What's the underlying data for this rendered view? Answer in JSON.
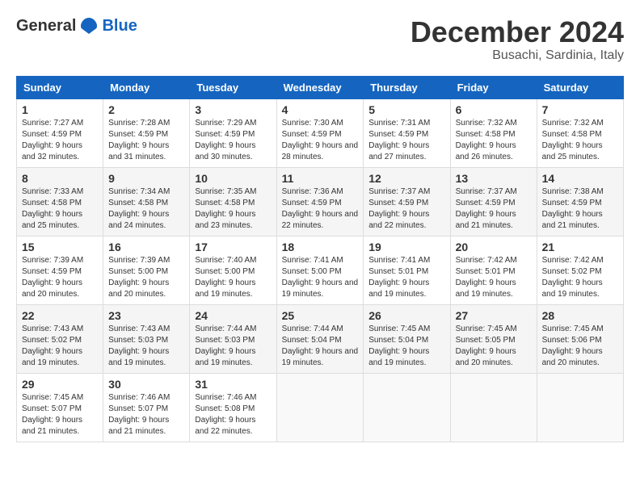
{
  "header": {
    "logo_general": "General",
    "logo_blue": "Blue",
    "month_title": "December 2024",
    "location": "Busachi, Sardinia, Italy"
  },
  "days_of_week": [
    "Sunday",
    "Monday",
    "Tuesday",
    "Wednesday",
    "Thursday",
    "Friday",
    "Saturday"
  ],
  "weeks": [
    [
      {
        "day": "1",
        "sunrise": "Sunrise: 7:27 AM",
        "sunset": "Sunset: 4:59 PM",
        "daylight": "Daylight: 9 hours and 32 minutes."
      },
      {
        "day": "2",
        "sunrise": "Sunrise: 7:28 AM",
        "sunset": "Sunset: 4:59 PM",
        "daylight": "Daylight: 9 hours and 31 minutes."
      },
      {
        "day": "3",
        "sunrise": "Sunrise: 7:29 AM",
        "sunset": "Sunset: 4:59 PM",
        "daylight": "Daylight: 9 hours and 30 minutes."
      },
      {
        "day": "4",
        "sunrise": "Sunrise: 7:30 AM",
        "sunset": "Sunset: 4:59 PM",
        "daylight": "Daylight: 9 hours and 28 minutes."
      },
      {
        "day": "5",
        "sunrise": "Sunrise: 7:31 AM",
        "sunset": "Sunset: 4:59 PM",
        "daylight": "Daylight: 9 hours and 27 minutes."
      },
      {
        "day": "6",
        "sunrise": "Sunrise: 7:32 AM",
        "sunset": "Sunset: 4:58 PM",
        "daylight": "Daylight: 9 hours and 26 minutes."
      },
      {
        "day": "7",
        "sunrise": "Sunrise: 7:32 AM",
        "sunset": "Sunset: 4:58 PM",
        "daylight": "Daylight: 9 hours and 25 minutes."
      }
    ],
    [
      {
        "day": "8",
        "sunrise": "Sunrise: 7:33 AM",
        "sunset": "Sunset: 4:58 PM",
        "daylight": "Daylight: 9 hours and 25 minutes."
      },
      {
        "day": "9",
        "sunrise": "Sunrise: 7:34 AM",
        "sunset": "Sunset: 4:58 PM",
        "daylight": "Daylight: 9 hours and 24 minutes."
      },
      {
        "day": "10",
        "sunrise": "Sunrise: 7:35 AM",
        "sunset": "Sunset: 4:58 PM",
        "daylight": "Daylight: 9 hours and 23 minutes."
      },
      {
        "day": "11",
        "sunrise": "Sunrise: 7:36 AM",
        "sunset": "Sunset: 4:59 PM",
        "daylight": "Daylight: 9 hours and 22 minutes."
      },
      {
        "day": "12",
        "sunrise": "Sunrise: 7:37 AM",
        "sunset": "Sunset: 4:59 PM",
        "daylight": "Daylight: 9 hours and 22 minutes."
      },
      {
        "day": "13",
        "sunrise": "Sunrise: 7:37 AM",
        "sunset": "Sunset: 4:59 PM",
        "daylight": "Daylight: 9 hours and 21 minutes."
      },
      {
        "day": "14",
        "sunrise": "Sunrise: 7:38 AM",
        "sunset": "Sunset: 4:59 PM",
        "daylight": "Daylight: 9 hours and 21 minutes."
      }
    ],
    [
      {
        "day": "15",
        "sunrise": "Sunrise: 7:39 AM",
        "sunset": "Sunset: 4:59 PM",
        "daylight": "Daylight: 9 hours and 20 minutes."
      },
      {
        "day": "16",
        "sunrise": "Sunrise: 7:39 AM",
        "sunset": "Sunset: 5:00 PM",
        "daylight": "Daylight: 9 hours and 20 minutes."
      },
      {
        "day": "17",
        "sunrise": "Sunrise: 7:40 AM",
        "sunset": "Sunset: 5:00 PM",
        "daylight": "Daylight: 9 hours and 19 minutes."
      },
      {
        "day": "18",
        "sunrise": "Sunrise: 7:41 AM",
        "sunset": "Sunset: 5:00 PM",
        "daylight": "Daylight: 9 hours and 19 minutes."
      },
      {
        "day": "19",
        "sunrise": "Sunrise: 7:41 AM",
        "sunset": "Sunset: 5:01 PM",
        "daylight": "Daylight: 9 hours and 19 minutes."
      },
      {
        "day": "20",
        "sunrise": "Sunrise: 7:42 AM",
        "sunset": "Sunset: 5:01 PM",
        "daylight": "Daylight: 9 hours and 19 minutes."
      },
      {
        "day": "21",
        "sunrise": "Sunrise: 7:42 AM",
        "sunset": "Sunset: 5:02 PM",
        "daylight": "Daylight: 9 hours and 19 minutes."
      }
    ],
    [
      {
        "day": "22",
        "sunrise": "Sunrise: 7:43 AM",
        "sunset": "Sunset: 5:02 PM",
        "daylight": "Daylight: 9 hours and 19 minutes."
      },
      {
        "day": "23",
        "sunrise": "Sunrise: 7:43 AM",
        "sunset": "Sunset: 5:03 PM",
        "daylight": "Daylight: 9 hours and 19 minutes."
      },
      {
        "day": "24",
        "sunrise": "Sunrise: 7:44 AM",
        "sunset": "Sunset: 5:03 PM",
        "daylight": "Daylight: 9 hours and 19 minutes."
      },
      {
        "day": "25",
        "sunrise": "Sunrise: 7:44 AM",
        "sunset": "Sunset: 5:04 PM",
        "daylight": "Daylight: 9 hours and 19 minutes."
      },
      {
        "day": "26",
        "sunrise": "Sunrise: 7:45 AM",
        "sunset": "Sunset: 5:04 PM",
        "daylight": "Daylight: 9 hours and 19 minutes."
      },
      {
        "day": "27",
        "sunrise": "Sunrise: 7:45 AM",
        "sunset": "Sunset: 5:05 PM",
        "daylight": "Daylight: 9 hours and 20 minutes."
      },
      {
        "day": "28",
        "sunrise": "Sunrise: 7:45 AM",
        "sunset": "Sunset: 5:06 PM",
        "daylight": "Daylight: 9 hours and 20 minutes."
      }
    ],
    [
      {
        "day": "29",
        "sunrise": "Sunrise: 7:45 AM",
        "sunset": "Sunset: 5:07 PM",
        "daylight": "Daylight: 9 hours and 21 minutes."
      },
      {
        "day": "30",
        "sunrise": "Sunrise: 7:46 AM",
        "sunset": "Sunset: 5:07 PM",
        "daylight": "Daylight: 9 hours and 21 minutes."
      },
      {
        "day": "31",
        "sunrise": "Sunrise: 7:46 AM",
        "sunset": "Sunset: 5:08 PM",
        "daylight": "Daylight: 9 hours and 22 minutes."
      },
      {
        "day": "",
        "sunrise": "",
        "sunset": "",
        "daylight": ""
      },
      {
        "day": "",
        "sunrise": "",
        "sunset": "",
        "daylight": ""
      },
      {
        "day": "",
        "sunrise": "",
        "sunset": "",
        "daylight": ""
      },
      {
        "day": "",
        "sunrise": "",
        "sunset": "",
        "daylight": ""
      }
    ]
  ]
}
